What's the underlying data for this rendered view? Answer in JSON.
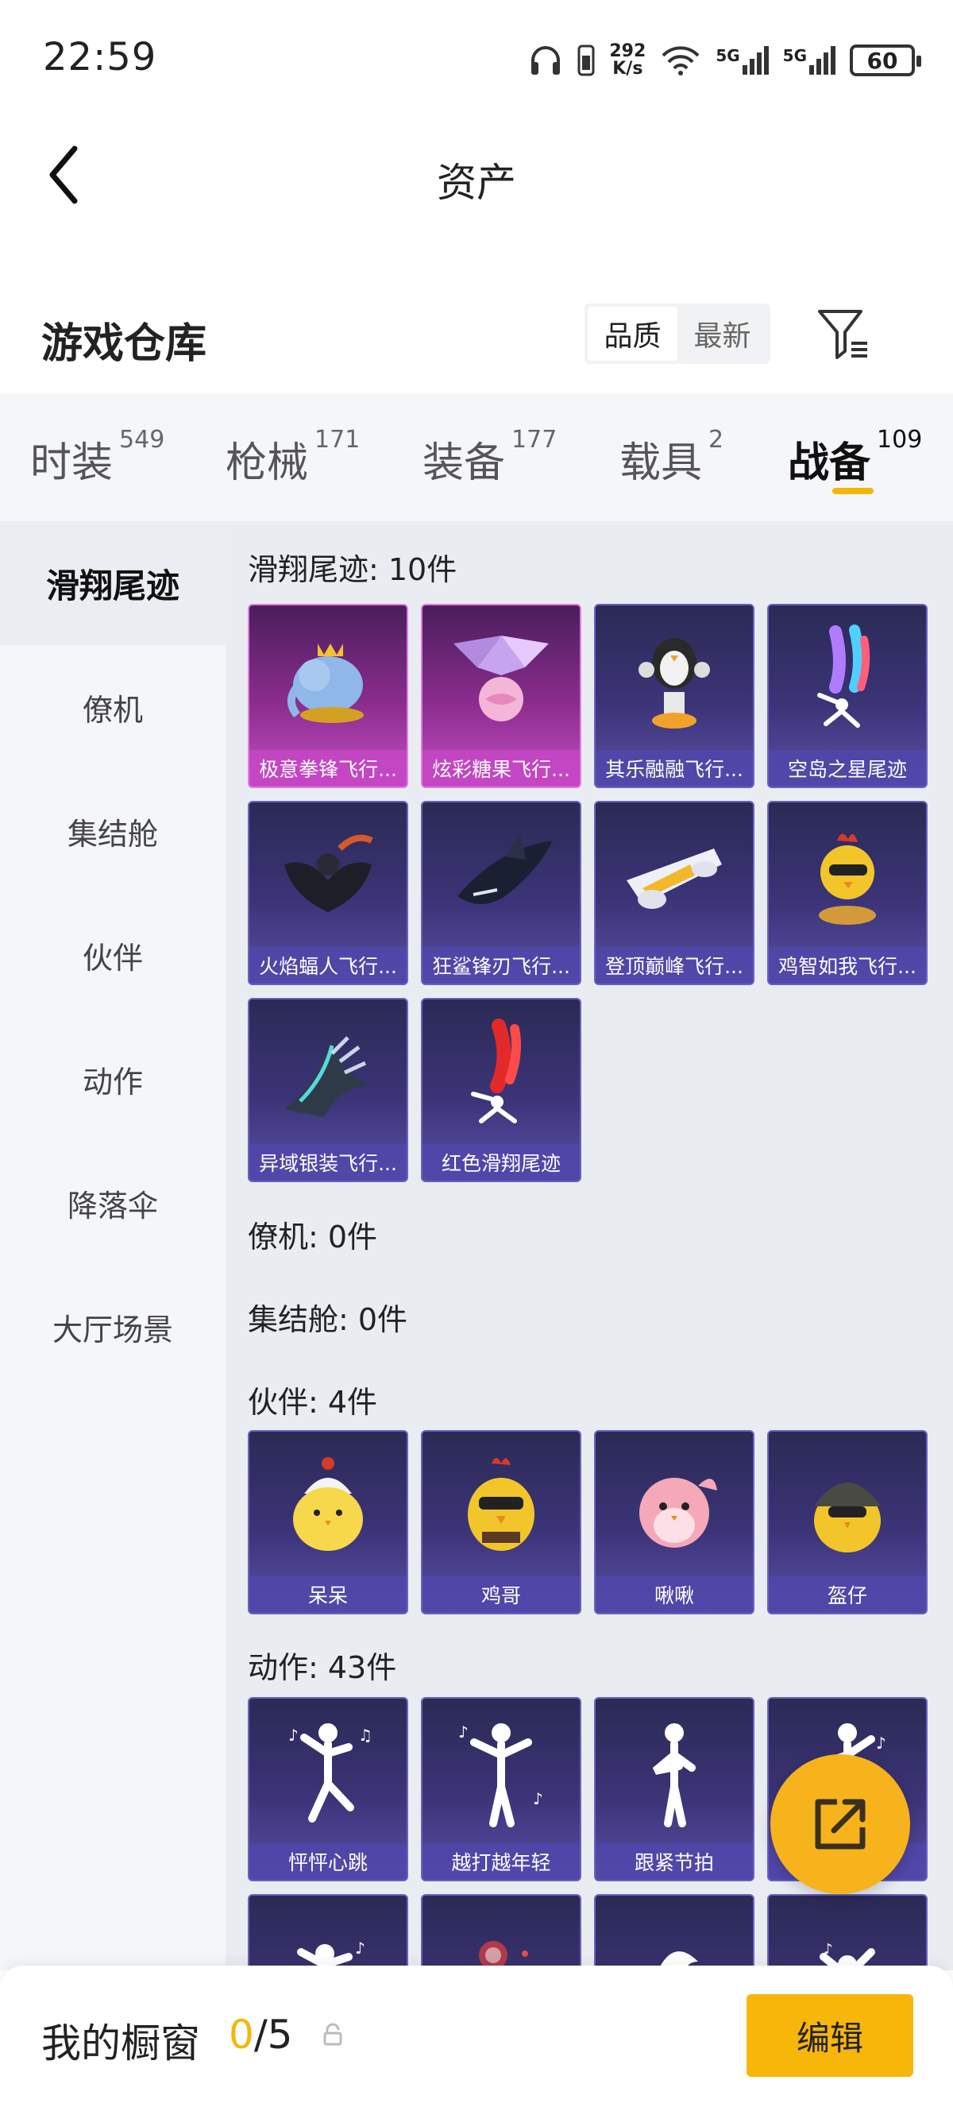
{
  "status_bar": {
    "time": "22:59",
    "net_rate_top": "292",
    "net_rate_bottom": "K/s",
    "sim1": "5G",
    "sim2": "5G",
    "battery": "60"
  },
  "header": {
    "title": "资产",
    "back_icon": "chevron-left-icon"
  },
  "warehouse": {
    "title": "游戏仓库",
    "sort_options": [
      "品质",
      "最新"
    ],
    "sort_active": "品质",
    "filter_icon": "filter-icon"
  },
  "tabs": [
    {
      "label": "时装",
      "count": "549"
    },
    {
      "label": "枪械",
      "count": "171"
    },
    {
      "label": "装备",
      "count": "177"
    },
    {
      "label": "载具",
      "count": "2"
    },
    {
      "label": "战备",
      "count": "109",
      "active": true
    }
  ],
  "sidebar": {
    "items": [
      {
        "label": "滑翔尾迹",
        "active": true
      },
      {
        "label": "僚机"
      },
      {
        "label": "集结舱"
      },
      {
        "label": "伙伴"
      },
      {
        "label": "动作"
      },
      {
        "label": "降落伞"
      },
      {
        "label": "大厅场景"
      }
    ]
  },
  "sections": {
    "glide": {
      "heading": "滑翔尾迹: 10件",
      "items": [
        "极意拳锋飞行...",
        "炫彩糖果飞行...",
        "其乐融融飞行...",
        "空岛之星尾迹",
        "火焰蝠人飞行...",
        "狂鲨锋刃飞行...",
        "登顶巅峰飞行...",
        "鸡智如我飞行...",
        "异域银装飞行...",
        "红色滑翔尾迹"
      ]
    },
    "wingman": {
      "heading": "僚机: 0件"
    },
    "pod": {
      "heading": "集结舱: 0件"
    },
    "partner": {
      "heading": "伙伴: 4件",
      "items": [
        "呆呆",
        "鸡哥",
        "啾啾",
        "盔仔"
      ]
    },
    "action": {
      "heading": "动作: 43件",
      "items": [
        "怦怦心跳",
        "越打越年轻",
        "跟紧节拍",
        ""
      ]
    }
  },
  "bottom_bar": {
    "title": "我的橱窗",
    "used": "0",
    "total": "/5",
    "edit_label": "编辑"
  },
  "colors": {
    "accent": "#f5b60a",
    "card_purple": "#3b3478",
    "card_pink": "#8c2d8f"
  }
}
